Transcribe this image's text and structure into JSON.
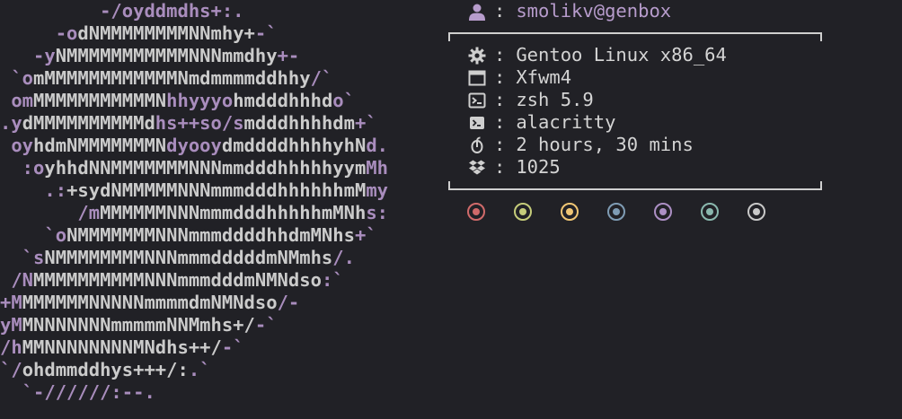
{
  "logo": {
    "lines": [
      [
        [
          "p",
          "         -/oyddmdhs+:."
        ]
      ],
      [
        [
          "p",
          "     -o"
        ],
        [
          "w",
          "dNMMMMMMMMNNmhy+"
        ],
        [
          "p",
          "-`"
        ]
      ],
      [
        [
          "p",
          "   -y"
        ],
        [
          "w",
          "NMMMMMMMMMMMNNNmmdhy"
        ],
        [
          "p",
          "+-"
        ]
      ],
      [
        [
          "p",
          " `o"
        ],
        [
          "w",
          "mMMMMMMMMMMMMNmdmmmmddhhy"
        ],
        [
          "p",
          "/`"
        ]
      ],
      [
        [
          "p",
          " om"
        ],
        [
          "w",
          "MMMMMMMMMMMN"
        ],
        [
          "p",
          "hhyyyo"
        ],
        [
          "w",
          "hmdddhhhd"
        ],
        [
          "p",
          "o`"
        ]
      ],
      [
        [
          "p",
          ".y"
        ],
        [
          "w",
          "dMMMMMMMMMMd"
        ],
        [
          "p",
          "hs++so/s"
        ],
        [
          "w",
          "mdddhhhhdm"
        ],
        [
          "p",
          "+`"
        ]
      ],
      [
        [
          "p",
          " oy"
        ],
        [
          "w",
          "hdmNMMMMMMMN"
        ],
        [
          "p",
          "dyooy"
        ],
        [
          "w",
          "dmddddhhhhyhN"
        ],
        [
          "p",
          "d."
        ]
      ],
      [
        [
          "p",
          "  :o"
        ],
        [
          "w",
          "yhhdNNMMMMMMMNNNmmdddhhhhhyym"
        ],
        [
          "p",
          "Mh"
        ]
      ],
      [
        [
          "p",
          "    .:"
        ],
        [
          "w",
          "+sydNMMMMMNNNmmmdddhhhhhhmM"
        ],
        [
          "p",
          "my"
        ]
      ],
      [
        [
          "p",
          "       /m"
        ],
        [
          "w",
          "MMMMMMNNNmmmdddhhhhhmMNh"
        ],
        [
          "p",
          "s:"
        ]
      ],
      [
        [
          "p",
          "    `o"
        ],
        [
          "w",
          "NMMMMMMMNNNmmmddddhhdmMNhs"
        ],
        [
          "p",
          "+`"
        ]
      ],
      [
        [
          "p",
          "  `s"
        ],
        [
          "w",
          "NMMMMMMMMNNNmmmdddddmNMmhs"
        ],
        [
          "p",
          "/."
        ]
      ],
      [
        [
          "p",
          " /N"
        ],
        [
          "w",
          "MMMMMMMMMMNNNmmmdddmNMNdso"
        ],
        [
          "p",
          ":`"
        ]
      ],
      [
        [
          "p",
          "+M"
        ],
        [
          "w",
          "MMMMMMNNNNNmmmmdmNMNdso"
        ],
        [
          "p",
          "/-"
        ]
      ],
      [
        [
          "p",
          "yM"
        ],
        [
          "w",
          "MNNNNNNNmmmmmNNMmhs+/"
        ],
        [
          "p",
          "-`"
        ]
      ],
      [
        [
          "p",
          "/h"
        ],
        [
          "w",
          "MMNNNNNNNNMNdhs++/"
        ],
        [
          "p",
          "-`"
        ]
      ],
      [
        [
          "p",
          "`/"
        ],
        [
          "w",
          "ohdmmddhys+++/:"
        ],
        [
          "p",
          ".`"
        ]
      ],
      [
        [
          "p",
          "  `-//////:--."
        ]
      ]
    ]
  },
  "info": {
    "user": {
      "icon": "user-icon",
      "sep": ":",
      "value": "smolikv@genbox"
    },
    "rows": [
      {
        "icon": "gear-icon",
        "sep": ":",
        "value": "Gentoo Linux x86_64"
      },
      {
        "icon": "window-icon",
        "sep": ":",
        "value": "Xfwm4"
      },
      {
        "icon": "terminal-icon",
        "sep": ":",
        "value": "zsh 5.9"
      },
      {
        "icon": "terminal-app-icon",
        "sep": ":",
        "value": "alacritty"
      },
      {
        "icon": "uptime-icon",
        "sep": ":",
        "value": "2 hours, 30 mins"
      },
      {
        "icon": "packages-icon",
        "sep": ":",
        "value": "1025"
      }
    ]
  },
  "palette": [
    {
      "ring": "#d06a6a",
      "center": "#d06a6a"
    },
    {
      "ring": "#c5cc7a",
      "center": "#c5cc7a"
    },
    {
      "ring": "#f0c674",
      "center": "#f0c674"
    },
    {
      "ring": "#7f9cb4",
      "center": "#7f9cb4"
    },
    {
      "ring": "#ac8fc4",
      "center": "#ac8fc4"
    },
    {
      "ring": "#8ab8ae",
      "center": "#8ab8ae"
    },
    {
      "ring": "#c8c8c8",
      "center": "#c8c8c8"
    }
  ]
}
